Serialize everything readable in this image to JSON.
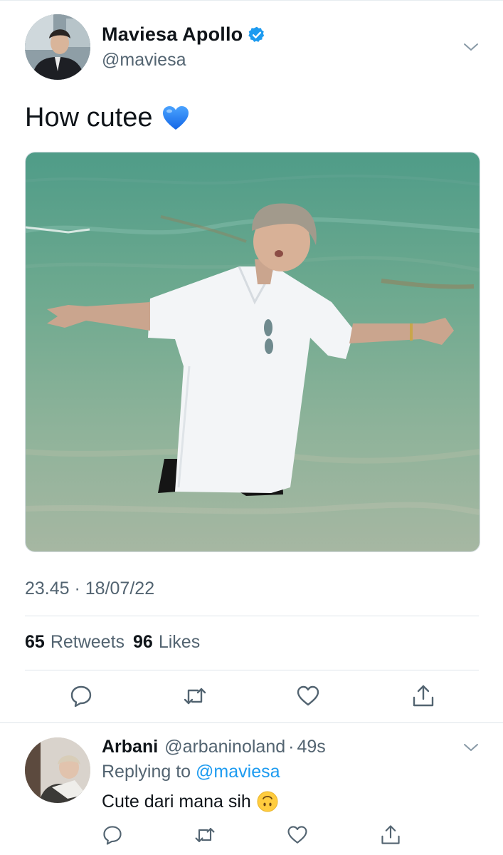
{
  "tweet": {
    "author_name": "Maviesa Apollo",
    "author_handle": "@maviesa",
    "text": "How cutee",
    "timestamp": "23.45 · 18/07/22",
    "retweets_count": "65",
    "retweets_label": "Retweets",
    "likes_count": "96",
    "likes_label": "Likes",
    "verified_color": "#1d9bf0",
    "emoji": "blue-heart-emoji"
  },
  "actions": [
    "reply-icon",
    "retweet-icon",
    "like-icon",
    "share-icon"
  ],
  "reply": {
    "author_name": "Arbani",
    "author_handle": "@arbaninoland",
    "separator": "·",
    "time": "49s",
    "replying_prefix": "Replying to",
    "replying_to": "@maviesa",
    "text": "Cute dari mana sih",
    "emoji": "upside-down-face-emoji"
  },
  "colors": {
    "text_primary": "#0f1419",
    "text_secondary": "#536471",
    "accent": "#1d9bf0",
    "divider": "#dfe5ea"
  }
}
